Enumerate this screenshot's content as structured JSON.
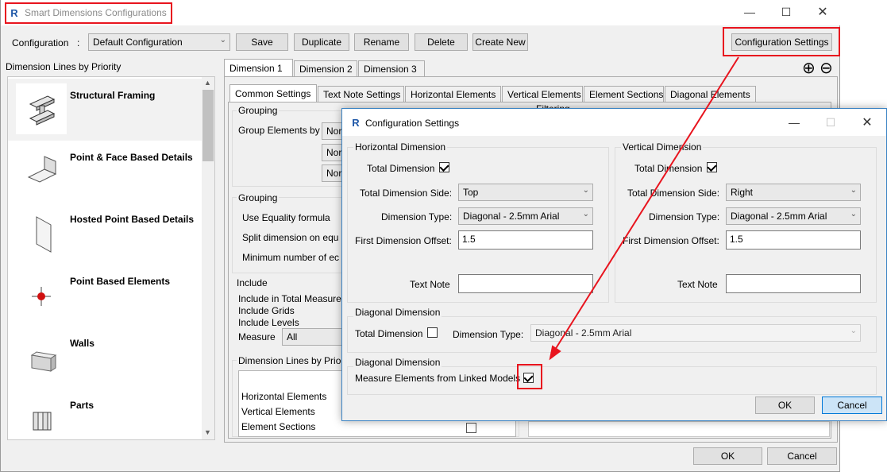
{
  "main_window": {
    "title": "Smart Dimensions Configurations",
    "toolbar": {
      "config_label": "Configuration",
      "config_colon": ":",
      "config_value": "Default Configuration",
      "save": "Save",
      "duplicate": "Duplicate",
      "rename": "Rename",
      "delete": "Delete",
      "create_new": "Create New",
      "config_settings": "Configuration Settings"
    },
    "priority_title": "Dimension Lines by Priority",
    "priority_items": [
      {
        "label": "Structural Framing"
      },
      {
        "label": "Point & Face Based Details"
      },
      {
        "label": "Hosted Point Based Details"
      },
      {
        "label": "Point Based Elements"
      },
      {
        "label": "Walls"
      },
      {
        "label": "Parts"
      }
    ],
    "dimension_tabs": [
      "Dimension 1",
      "Dimension 2",
      "Dimension 3"
    ],
    "sub_tabs": [
      "Common Settings",
      "Text Note Settings",
      "Horizontal Elements",
      "Vertical Elements",
      "Element Sections",
      "Diagonal Elements"
    ],
    "grouping1": {
      "title": "Grouping",
      "group_elements_by": "Group Elements by",
      "combo_values": [
        "Nor",
        "Nor",
        "Nor"
      ]
    },
    "filtering_label": "Filtering",
    "grouping2": {
      "title": "Grouping",
      "use_equality": "Use Equality formula",
      "split_dimension": "Split dimension on equ",
      "minimum_number": "Minimum number of ec"
    },
    "include": {
      "title": "Include",
      "total_measure": "Include in Total Measure",
      "grids": "Include Grids",
      "levels": "Include Levels",
      "measure_label": "Measure",
      "measure_value": "All"
    },
    "dim_lines_priority": {
      "title": "Dimension Lines by Priori",
      "rows": [
        "Horizontal Elements",
        "Vertical Elements",
        "Element Sections"
      ]
    },
    "ok": "OK",
    "cancel": "Cancel"
  },
  "dialog": {
    "title": "Configuration Settings",
    "horizontal": {
      "title": "Horizontal Dimension",
      "total_dimension": "Total Dimension",
      "total_dimension_checked": true,
      "side_label": "Total Dimension Side:",
      "side_value": "Top",
      "type_label": "Dimension Type:",
      "type_value": "Diagonal - 2.5mm Arial",
      "offset_label": "First Dimension Offset:",
      "offset_value": "1.5",
      "text_note_label": "Text Note",
      "text_note_value": ""
    },
    "vertical": {
      "title": "Vertical Dimension",
      "total_dimension": "Total Dimension",
      "total_dimension_checked": true,
      "side_label": "Total Dimension Side:",
      "side_value": "Right",
      "type_label": "Dimension Type:",
      "type_value": "Diagonal - 2.5mm Arial",
      "offset_label": "First Dimension Offset:",
      "offset_value": "1.5",
      "text_note_label": "Text Note",
      "text_note_value": ""
    },
    "diagonal": {
      "title": "Diagonal Dimension",
      "total_dimension": "Total Dimension",
      "total_dimension_checked": false,
      "type_label": "Dimension Type:",
      "type_value": "Diagonal - 2.5mm Arial"
    },
    "linked": {
      "title": "Diagonal Dimension",
      "measure_linked": "Measure Elements from Linked Models",
      "measure_linked_checked": true
    },
    "ok": "OK",
    "cancel": "Cancel"
  },
  "app_icon_letter": "R",
  "icons": {
    "minimize": "minimize-icon",
    "maximize": "maximize-icon",
    "close": "close-icon",
    "add": "add-circle-icon",
    "remove": "remove-circle-icon",
    "chevron": "chevron-down-icon"
  },
  "colors": {
    "callout": "#e8141e",
    "accent": "#0078d7",
    "app_icon": "#1f58a8"
  }
}
